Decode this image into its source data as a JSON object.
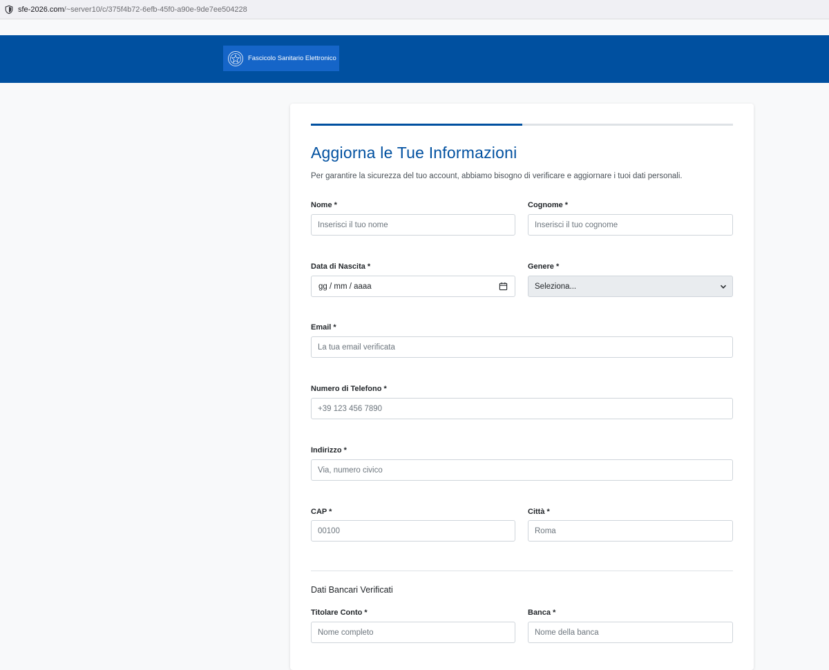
{
  "browser": {
    "url_host": "sfe-2026.com",
    "url_path": "/~server10/c/375f4b72-6efb-45f0-a90e-9de7ee504228"
  },
  "header": {
    "brand_text": "Fascicolo Sanitario Elettronico",
    "colors": {
      "banner": "#0050a0",
      "brand_box": "#1565c8"
    }
  },
  "form": {
    "progress_fraction": 0.5,
    "title": "Aggiorna le Tue Informazioni",
    "subtitle": "Per garantire la sicurezza del tuo account, abbiamo bisogno di verificare e aggiornare i tuoi dati personali.",
    "fields": {
      "nome": {
        "label": "Nome *",
        "placeholder": "Inserisci il tuo nome"
      },
      "cognome": {
        "label": "Cognome *",
        "placeholder": "Inserisci il tuo cognome"
      },
      "data_nascita": {
        "label": "Data di Nascita *",
        "placeholder": "gg / mm / aaaa"
      },
      "genere": {
        "label": "Genere *",
        "selected": "Seleziona..."
      },
      "email": {
        "label": "Email *",
        "placeholder": "La tua email verificata"
      },
      "telefono": {
        "label": "Numero di Telefono *",
        "placeholder": "+39 123 456 7890"
      },
      "indirizzo": {
        "label": "Indirizzo *",
        "placeholder": "Via, numero civico"
      },
      "cap": {
        "label": "CAP *",
        "placeholder": "00100"
      },
      "citta": {
        "label": "Città *",
        "placeholder": "Roma"
      },
      "titolare": {
        "label": "Titolare Conto *",
        "placeholder": "Nome completo"
      },
      "banca": {
        "label": "Banca *",
        "placeholder": "Nome della banca"
      }
    },
    "bank_section_title": "Dati Bancari Verificati",
    "icons": {
      "date": "calendar-icon",
      "select": "chevron-down-icon",
      "security": "shield-icon",
      "emblem": "emblem-icon"
    }
  }
}
